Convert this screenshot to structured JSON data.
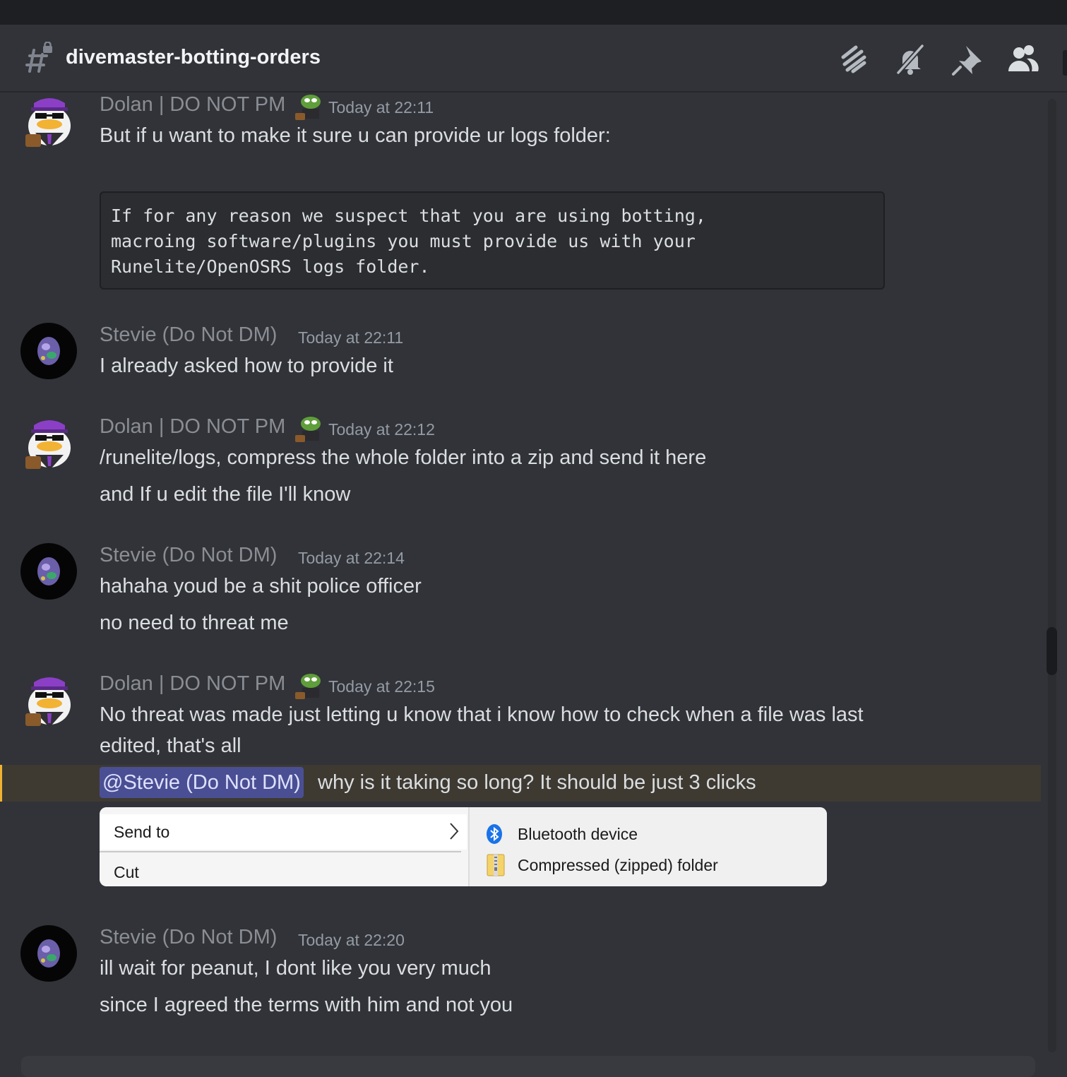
{
  "channel": {
    "name": "divemaster-botting-orders",
    "header_icons": [
      "threads-icon",
      "mute-bell-icon",
      "pin-icon",
      "members-icon"
    ]
  },
  "messages": [
    {
      "author": "Dolan | DO NOT PM",
      "time": "Today at 22:11",
      "lines": [
        "But if u want to make it sure u can provide ur logs folder:"
      ],
      "code": [
        "If for any reason we suspect that you are using botting,",
        "macroing software/plugins you must provide us with your",
        "Runelite/OpenOSRS logs folder."
      ]
    },
    {
      "author": "Stevie (Do Not DM)",
      "time": "Today at 22:11",
      "lines": [
        "I already asked how to provide it"
      ]
    },
    {
      "author": "Dolan | DO NOT PM",
      "time": "Today at 22:12",
      "lines": [
        "/runelite/logs, compress the whole folder into a zip and send it here",
        "and If u edit the file I'll know"
      ]
    },
    {
      "author": "Stevie (Do Not DM)",
      "time": "Today at 22:14",
      "lines": [
        "hahaha youd be a shit police officer",
        "no need to threat me"
      ]
    },
    {
      "author": "Dolan | DO NOT PM",
      "time": "Today at 22:15",
      "lines": [
        "No threat was made just letting u know that i know how to check when a file was last",
        "edited, that's all"
      ],
      "mention": "@Stevie (Do Not DM)",
      "mention_text": "why is it taking so long? It should be just 3 clicks",
      "attachment": {
        "send_to": "Send to",
        "cut": "Cut",
        "bluetooth": "Bluetooth device",
        "zip": "Compressed (zipped) folder"
      }
    },
    {
      "author": "Stevie (Do Not DM)",
      "time": "Today at 22:20",
      "lines": [
        "ill wait for peanut, I dont like you very much",
        "since I agreed the terms with him and not you"
      ]
    }
  ],
  "colors": {
    "background": "#313338",
    "mention_bg": "#4a4f94",
    "highlight_bar": "#f0b232",
    "author_muted": "#8a8d93"
  }
}
